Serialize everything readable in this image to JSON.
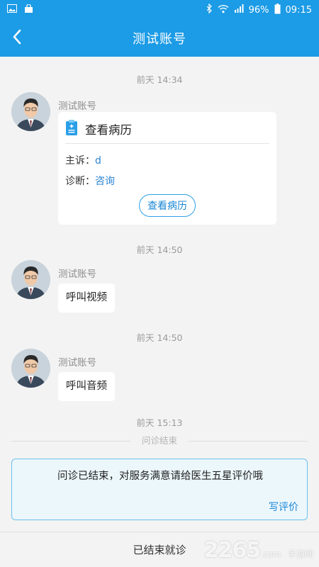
{
  "status_bar": {
    "battery": "96%",
    "time": "09:15"
  },
  "header": {
    "title": "测试账号"
  },
  "messages": [
    {
      "time": "前天 14:34",
      "sender": "测试账号",
      "card": {
        "title": "查看病历",
        "complaint_label": "主诉：",
        "complaint_value": "d",
        "diagnosis_label": "诊断：",
        "diagnosis_value": "咨询",
        "button": "查看病历"
      }
    },
    {
      "time": "前天 14:50",
      "sender": "测试账号",
      "text": "呼叫视频"
    },
    {
      "time": "前天 14:50",
      "sender": "测试账号",
      "text": "呼叫音频"
    }
  ],
  "end_time": "前天 15:13",
  "divider_label": "问诊结束",
  "notice": {
    "text": "问诊已结束，对服务满意请给医生五星评价哦",
    "link": "写评价"
  },
  "bottom": {
    "label": "已结束就诊"
  },
  "watermark": {
    "main": "2265",
    "sub": ".com",
    "side": "手游网"
  },
  "colors": {
    "primary": "#1c9be6",
    "link": "#1a86d6",
    "notice_bg": "#ecf7fc"
  }
}
